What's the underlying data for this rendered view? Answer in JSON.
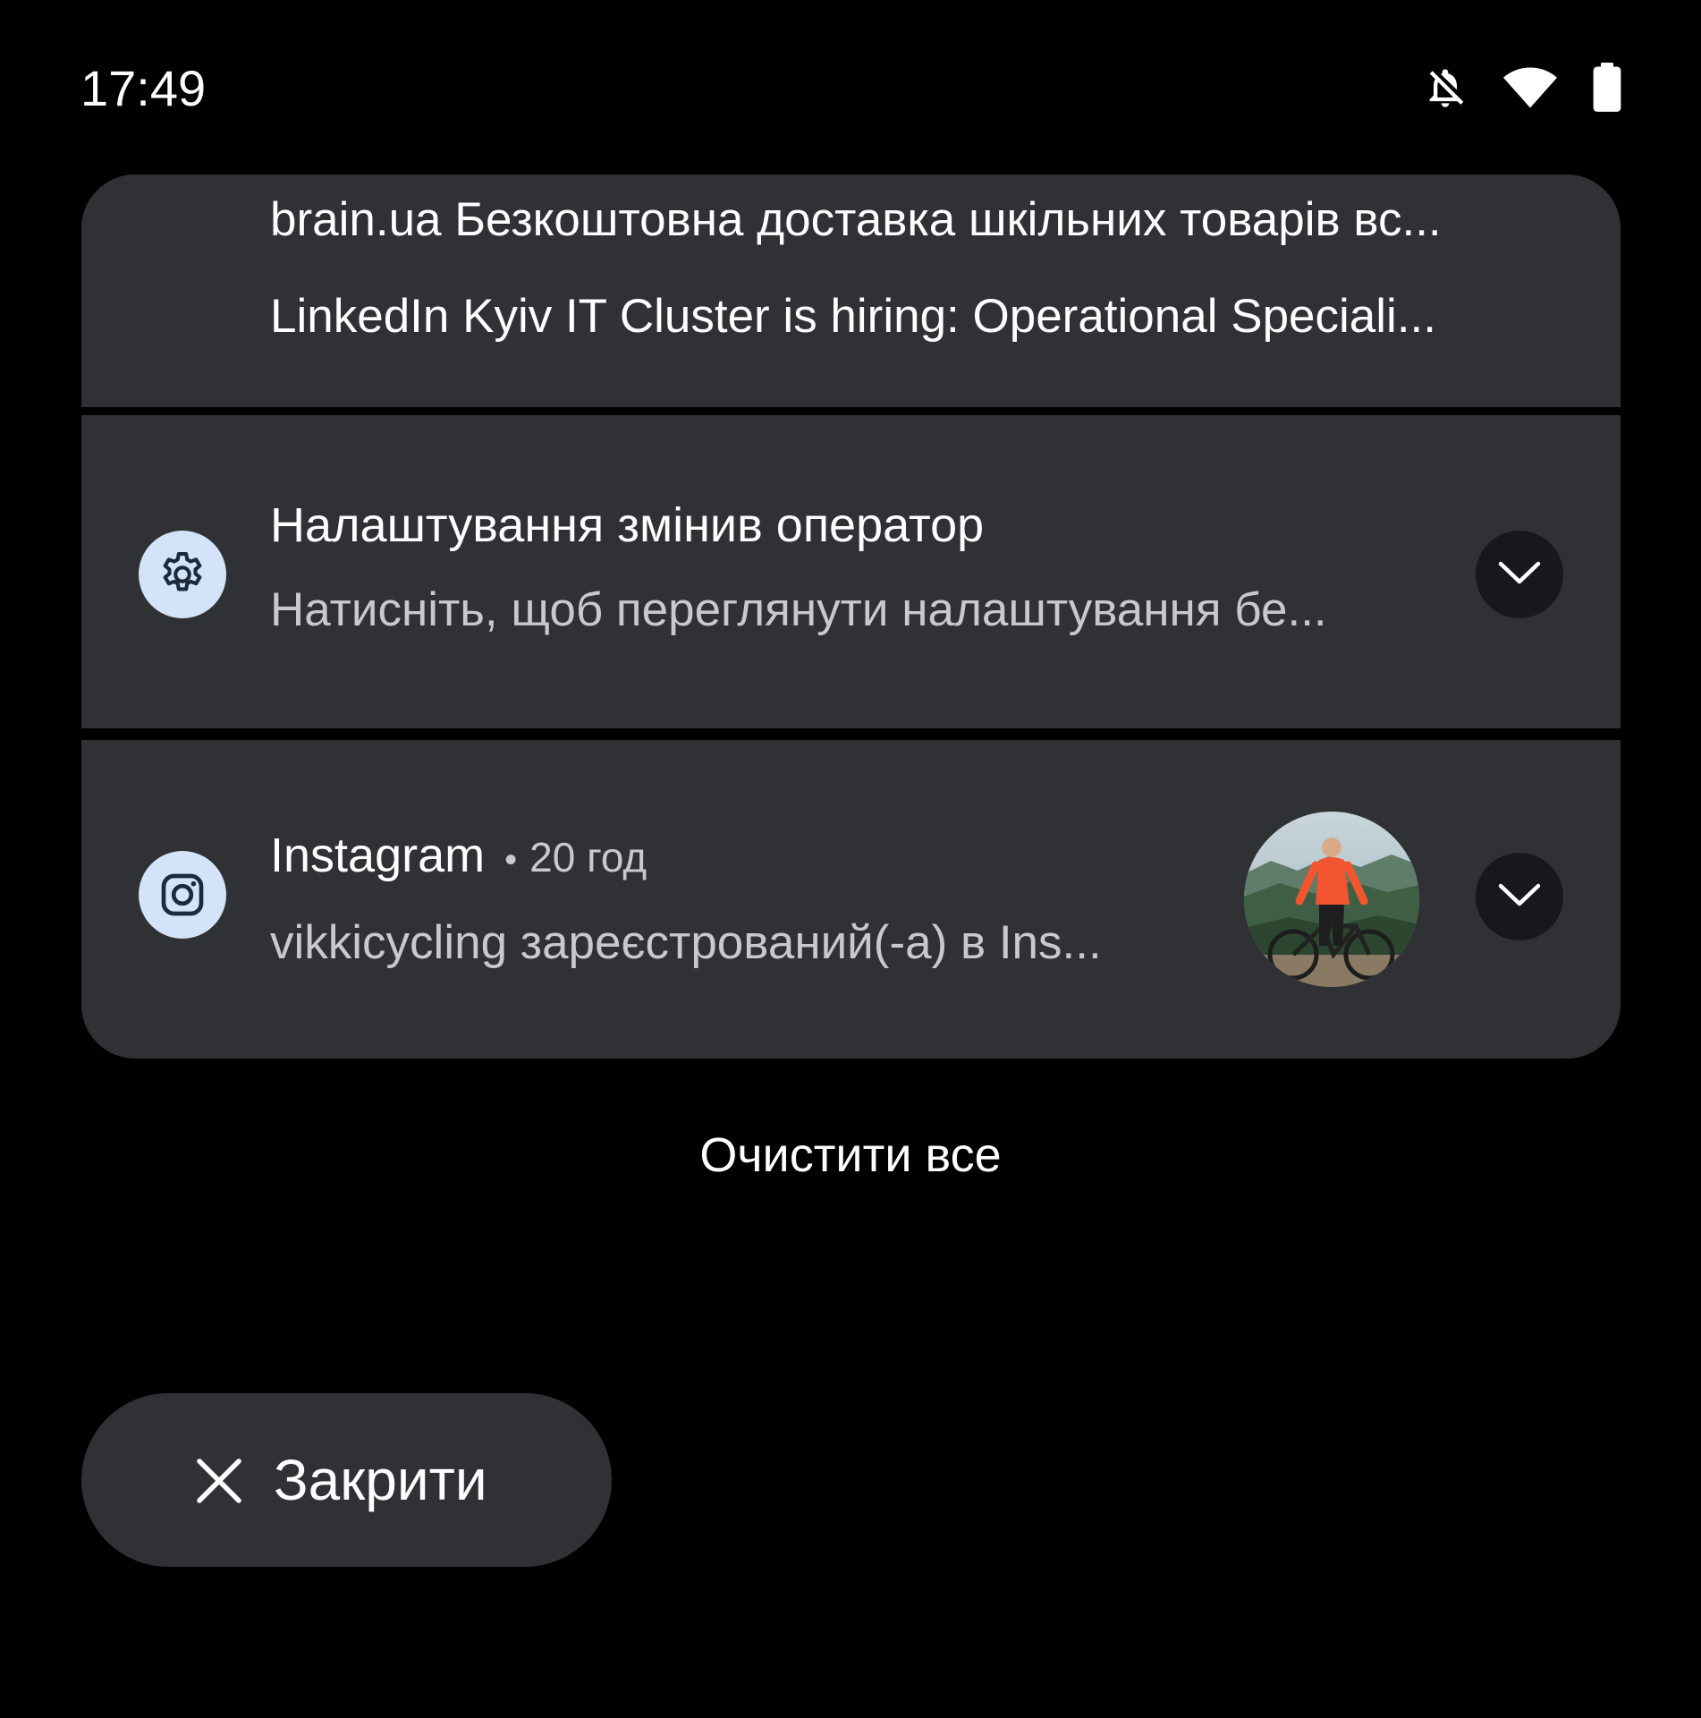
{
  "status_bar": {
    "time": "17:49",
    "icons": [
      "bell-off-icon",
      "wifi-icon",
      "battery-icon"
    ]
  },
  "notifications": {
    "grouped_lines": [
      "brain.ua Безкоштовна доставка шкільних товарів вс...",
      "LinkedIn Kyiv IT Cluster is hiring: Operational Speciali..."
    ],
    "settings_notification": {
      "icon": "gear-icon",
      "title": "Налаштування змінив оператор",
      "body": "Натисніть, щоб переглянути налаштування бе..."
    },
    "instagram_notification": {
      "icon": "instagram-icon",
      "app": "Instagram",
      "separator": "•",
      "time": "20 год",
      "body": "vikkicycling зареєстрований(-а) в Ins..."
    }
  },
  "actions": {
    "clear_all": "Очистити все",
    "close": "Закрити"
  },
  "colors": {
    "background": "#000000",
    "card": "#2f3135",
    "icon_bg": "#d3e4f8",
    "icon_fg": "#1b2a3a",
    "secondary_text": "#c7c9cd"
  }
}
